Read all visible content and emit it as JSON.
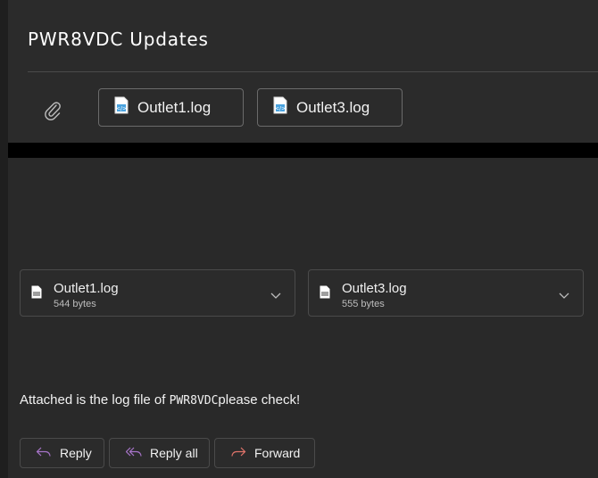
{
  "email": {
    "subject": "PWR8VDC Updates",
    "top_attachments": [
      {
        "name": "Outlet1.log"
      },
      {
        "name": "Outlet3.log"
      }
    ],
    "files": [
      {
        "name": "Outlet1.log",
        "size": "544 bytes"
      },
      {
        "name": "Outlet3.log",
        "size": "555 bytes"
      }
    ],
    "message": {
      "before": "Attached is the log file of ",
      "device": "PWR8VDC",
      "after": "please check!"
    }
  },
  "actions": {
    "reply": "Reply",
    "reply_all": "Reply all",
    "forward": "Forward"
  },
  "colors": {
    "background": "#292929",
    "text": "#ffffff",
    "border": "#4a4a4a",
    "file_icon_accent": "#4aa3df",
    "reply_icon": "#a774c9",
    "forward_icon": "#e0736a"
  },
  "icons": {
    "paperclip": "paperclip-icon",
    "file": "log-file-icon",
    "chevron": "chevron-down-icon",
    "reply": "reply-icon",
    "reply_all": "reply-all-icon",
    "forward": "forward-icon"
  }
}
